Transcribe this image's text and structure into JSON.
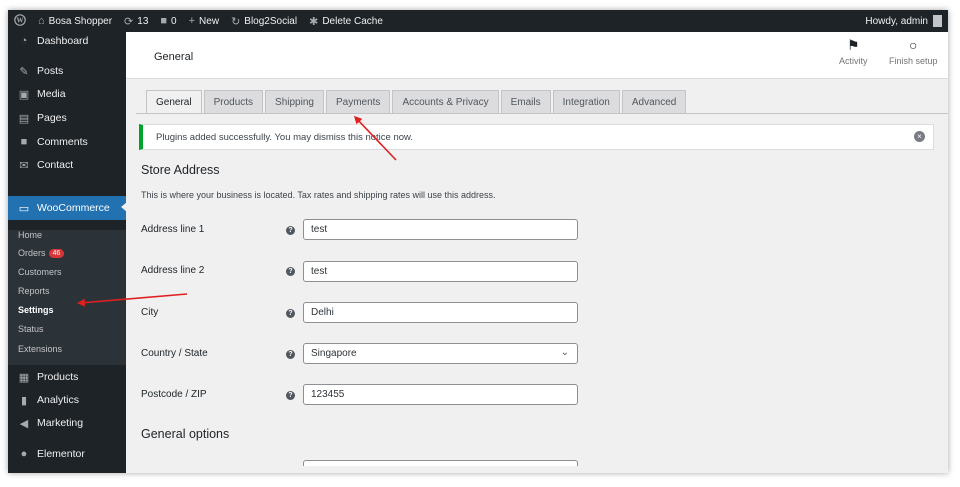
{
  "adminbar": {
    "site_name": "Bosa Shopper",
    "updates_count": "13",
    "comments_count": "0",
    "new_label": "New",
    "blog2social_label": "Blog2Social",
    "delete_cache_label": "Delete Cache",
    "howdy_label": "Howdy, admin"
  },
  "sidebar": {
    "dashboard": "Dashboard",
    "posts": "Posts",
    "media": "Media",
    "pages": "Pages",
    "comments": "Comments",
    "contact": "Contact",
    "woocommerce": "WooCommerce",
    "submenu": {
      "home": "Home",
      "orders": "Orders",
      "orders_badge": "46",
      "customers": "Customers",
      "reports": "Reports",
      "settings": "Settings",
      "status": "Status",
      "extensions": "Extensions"
    },
    "products": "Products",
    "analytics": "Analytics",
    "marketing": "Marketing",
    "elementor": "Elementor"
  },
  "header": {
    "title": "General",
    "activity_label": "Activity",
    "finish_setup_label": "Finish setup"
  },
  "tabs": [
    "General",
    "Products",
    "Shipping",
    "Payments",
    "Accounts & Privacy",
    "Emails",
    "Integration",
    "Advanced"
  ],
  "notice": {
    "text": "Plugins added successfully. You may dismiss this notice now.",
    "accent": "#00a32a"
  },
  "store_address": {
    "title": "Store Address",
    "description": "This is where your business is located. Tax rates and shipping rates will use this address.",
    "fields": {
      "address1": {
        "label": "Address line 1",
        "value": "test"
      },
      "address2": {
        "label": "Address line 2",
        "value": "test"
      },
      "city": {
        "label": "City",
        "value": "Delhi"
      },
      "country": {
        "label": "Country / State",
        "value": "Singapore"
      },
      "postcode": {
        "label": "Postcode / ZIP",
        "value": "123455"
      }
    }
  },
  "general_options": {
    "title": "General options"
  },
  "colors": {
    "admin_dark": "#1d2327",
    "accent_blue": "#2271b1",
    "annotation_red": "#e02020"
  }
}
